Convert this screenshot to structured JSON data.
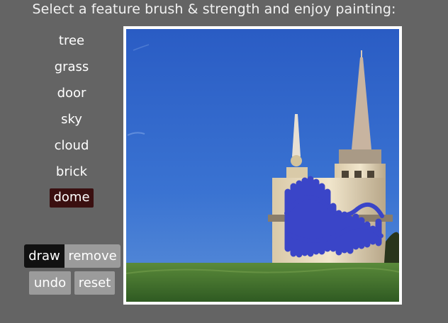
{
  "header": {
    "title": "Select a feature brush & strength and enjoy painting:"
  },
  "brushes": [
    {
      "label": "tree",
      "selected": false
    },
    {
      "label": "grass",
      "selected": false
    },
    {
      "label": "door",
      "selected": false
    },
    {
      "label": "sky",
      "selected": false
    },
    {
      "label": "cloud",
      "selected": false
    },
    {
      "label": "brick",
      "selected": false
    },
    {
      "label": "dome",
      "selected": true
    }
  ],
  "mode": {
    "draw_label": "draw",
    "remove_label": "remove",
    "active": "draw"
  },
  "actions": {
    "undo_label": "undo",
    "reset_label": "reset"
  },
  "canvas": {
    "image_description": "church with two spires under blue sky, green grass at bottom",
    "stroke_color": "#3a45c8",
    "sky_color": "#2f63c8",
    "grass_color": "#4a7a2a"
  },
  "colors": {
    "background": "#646464",
    "selected_brush": "#3a0f10",
    "active_button": "#111111",
    "inactive_button": "#9b9b9b"
  }
}
